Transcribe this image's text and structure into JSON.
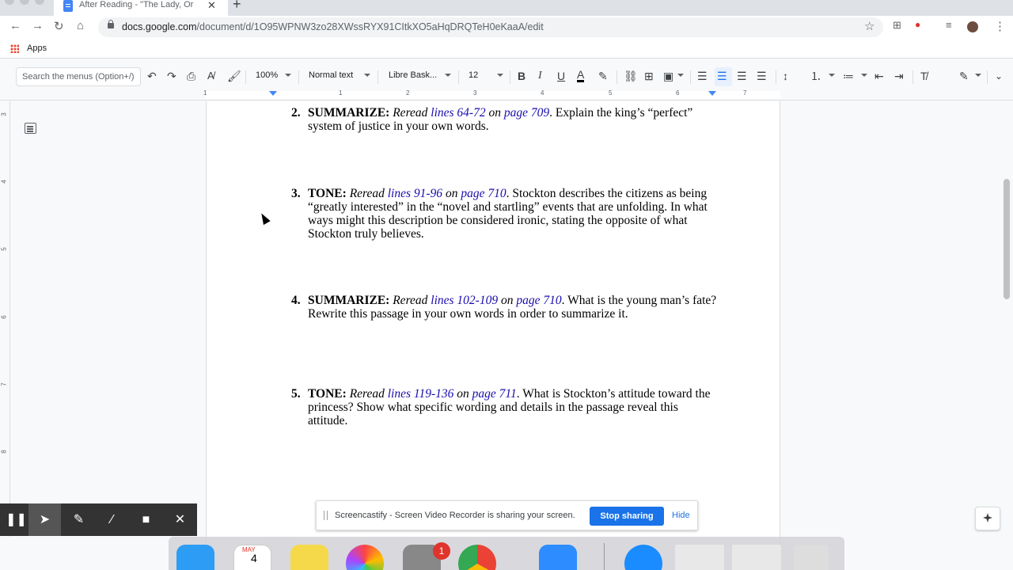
{
  "browser": {
    "tab_title": "After Reading - \"The Lady, Or",
    "url_host": "docs.google.com",
    "url_path": "/document/d/1O95WPNW3zo28XWssRYX91CItkXO5aHqDRQTeH0eKaaA/edit",
    "bookmark_apps": "Apps"
  },
  "toolbar": {
    "menu_search_placeholder": "Search the menus (Option+/)",
    "zoom": "100%",
    "style": "Normal text",
    "font": "Libre Bask...",
    "font_size": "12"
  },
  "ruler": {
    "numbers": [
      "1",
      "1",
      "2",
      "3",
      "4",
      "5",
      "6",
      "7"
    ]
  },
  "vertical_ruler": {
    "numbers": [
      "3",
      "4",
      "5",
      "6",
      "7",
      "8"
    ]
  },
  "document": {
    "questions": [
      {
        "num": "2.",
        "label": "SUMMARIZE:",
        "reread": "Reread",
        "lines": "lines 64-72",
        "on": "on",
        "page": "page 709",
        "text": ". Explain the king’s “perfect” system of justice in your own words."
      },
      {
        "num": "3.",
        "label": "TONE:",
        "reread": "Reread",
        "lines": "lines 91-96",
        "on": "on",
        "page": "page 710",
        "text": ". Stockton describes the citizens as being “greatly interested” in the “novel and startling” events that are unfolding. In what ways might this description be considered ironic, stating the opposite of what Stockton truly believes."
      },
      {
        "num": "4.",
        "label": "SUMMARIZE:",
        "reread": "Reread",
        "lines": "lines 102-109",
        "on": "on",
        "page": "page 710",
        "text": ". What is the young man’s fate? Rewrite this passage in your own words in order to summarize it."
      },
      {
        "num": "5.",
        "label": "TONE:",
        "reread": "Reread",
        "lines": "lines 119-136",
        "on": "on",
        "page": "page 711",
        "text": ". What is Stockton’s attitude toward the princess? Show what specific wording and details in the passage reveal this attitude."
      }
    ]
  },
  "screencastify": {
    "message": "Screencastify - Screen Video Recorder is sharing your screen.",
    "stop_label": "Stop sharing",
    "hide_label": "Hide"
  },
  "dock": {
    "calendar_month": "MAY",
    "calendar_day": "4",
    "badge_count": "1"
  },
  "colors": {
    "link_blue": "#1a0dab",
    "stop_button": "#1a73e8",
    "recorder_bar": "#333333",
    "badge_red": "#e0332c"
  }
}
